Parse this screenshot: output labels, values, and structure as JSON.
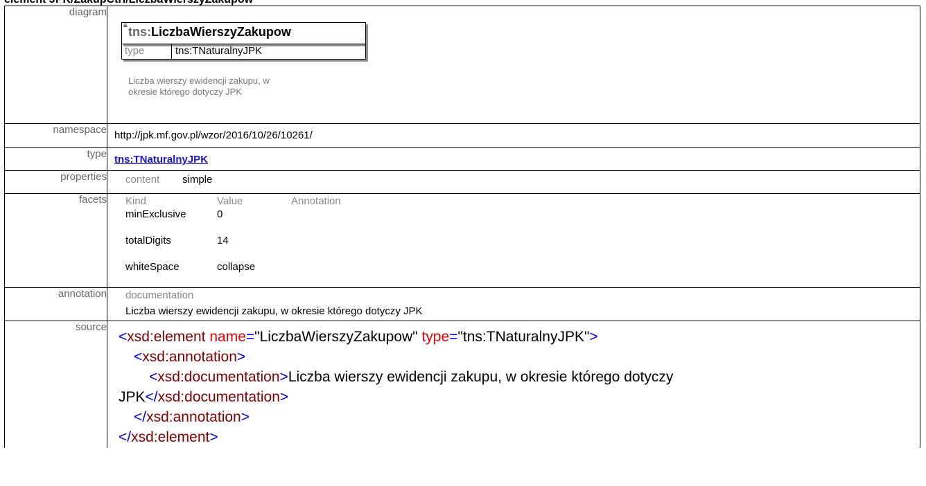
{
  "page_title": "element JPK/ZakupCtrl/LiczbaWierszyZakupow",
  "rows": {
    "diagram": "diagram",
    "namespace": "namespace",
    "type": "type",
    "properties": "properties",
    "facets": "facets",
    "annotation": "annotation",
    "source": "source"
  },
  "diagram": {
    "prefix": "tns:",
    "name": "LiczbaWierszyZakupow",
    "type_key": "type",
    "type_value": "tns:TNaturalnyJPK",
    "desc_line1": "Liczba wierszy ewidencji zakupu, w",
    "desc_line2": "okresie którego dotyczy JPK"
  },
  "namespace_value": "http://jpk.mf.gov.pl/wzor/2016/10/26/10261/",
  "type_link": "tns:TNaturalnyJPK",
  "properties": {
    "key": "content",
    "value": "simple"
  },
  "facets": {
    "headers": [
      "Kind",
      "Value",
      "Annotation"
    ],
    "rows": [
      {
        "kind": "minExclusive",
        "value": "0"
      },
      {
        "kind": "totalDigits",
        "value": "14"
      },
      {
        "kind": "whiteSpace",
        "value": "collapse"
      }
    ]
  },
  "annotation": {
    "key": "documentation",
    "value": "Liczba wierszy ewidencji zakupu, w okresie którego dotyczy JPK"
  },
  "source": {
    "lt": "<",
    "gt": ">",
    "eq": "=",
    "element_tag": "xsd:element",
    "name_attr": "name",
    "name_val": "\"LiczbaWierszyZakupow\"",
    "type_attr": "type",
    "type_val": "\"tns:TNaturalnyJPK\"",
    "annotation_tag": "xsd:annotation",
    "documentation_tag": "xsd:documentation",
    "doc_text_1": "Liczba wierszy ewidencji zakupu, w okresie którego dotyczy",
    "doc_text_2": "JPK",
    "close_documentation": "</",
    "close_annotation": "</",
    "close_element": "</"
  }
}
